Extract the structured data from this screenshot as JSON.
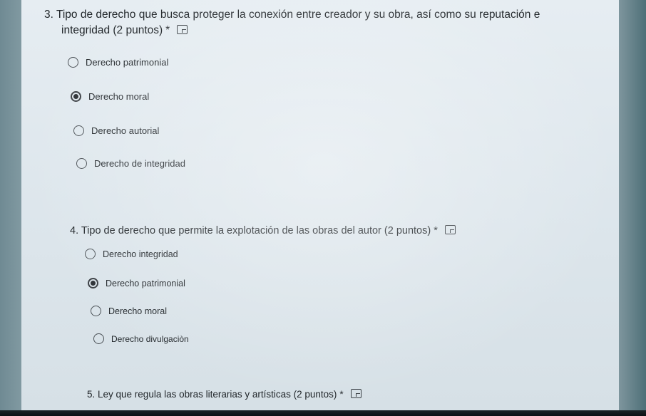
{
  "q3": {
    "title_line1": "3. Tipo de derecho que busca proteger la conexión entre creador y su obra, así como su reputación e",
    "title_line2": "integridad (2 puntos)",
    "required_mark": "*",
    "options": [
      "Derecho patrimonial",
      "Derecho moral",
      "Derecho autorial",
      "Derecho de integridad"
    ],
    "selected": "Derecho moral"
  },
  "q4": {
    "title": "4. Tipo de derecho que permite la explotación de las obras del autor  (2 puntos)",
    "required_mark": "*",
    "options": [
      "Derecho integridad",
      "Derecho patrimonial",
      "Derecho moral",
      "Derecho divulgaciòn"
    ],
    "selected": "Derecho patrimonial"
  },
  "q5": {
    "title": "5. Ley que regula las obras literarias y artísticas  (2 puntos)",
    "required_mark": "*"
  },
  "icons": {
    "image_search": "image-icon"
  }
}
